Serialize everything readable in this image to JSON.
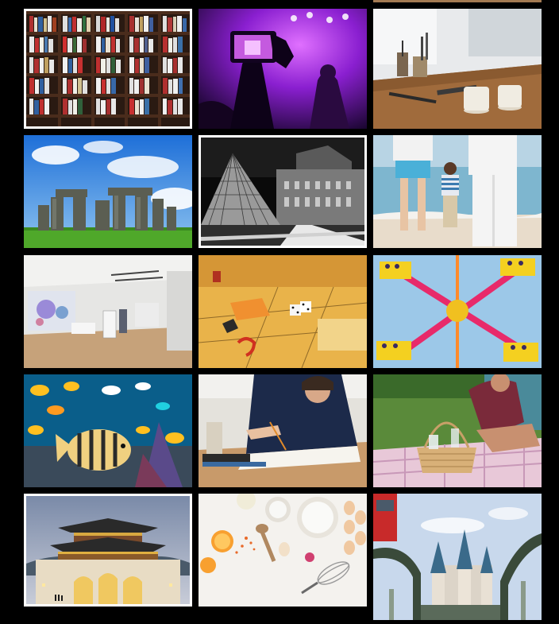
{
  "gallery": {
    "tiles": [
      {
        "subject": "bookshelf",
        "selected": true
      },
      {
        "subject": "concert-phone",
        "selected": false
      },
      {
        "subject": "craft-workbench",
        "selected": false
      },
      {
        "subject": "stonehenge",
        "selected": false
      },
      {
        "subject": "louvre-pyramid",
        "selected": true
      },
      {
        "subject": "family-beach",
        "selected": false
      },
      {
        "subject": "gallery-room",
        "selected": false
      },
      {
        "subject": "board-game",
        "selected": false
      },
      {
        "subject": "amusement-ride",
        "selected": false
      },
      {
        "subject": "aquarium-fish",
        "selected": false
      },
      {
        "subject": "student-desk",
        "selected": false
      },
      {
        "subject": "picnic-basket",
        "selected": false
      },
      {
        "subject": "korean-palace-gate",
        "selected": true
      },
      {
        "subject": "baking-ingredients",
        "selected": false
      },
      {
        "subject": "theme-park-castle",
        "selected": false
      }
    ]
  },
  "colors": {
    "background": "#000000",
    "selection_border": "#ffffff"
  }
}
